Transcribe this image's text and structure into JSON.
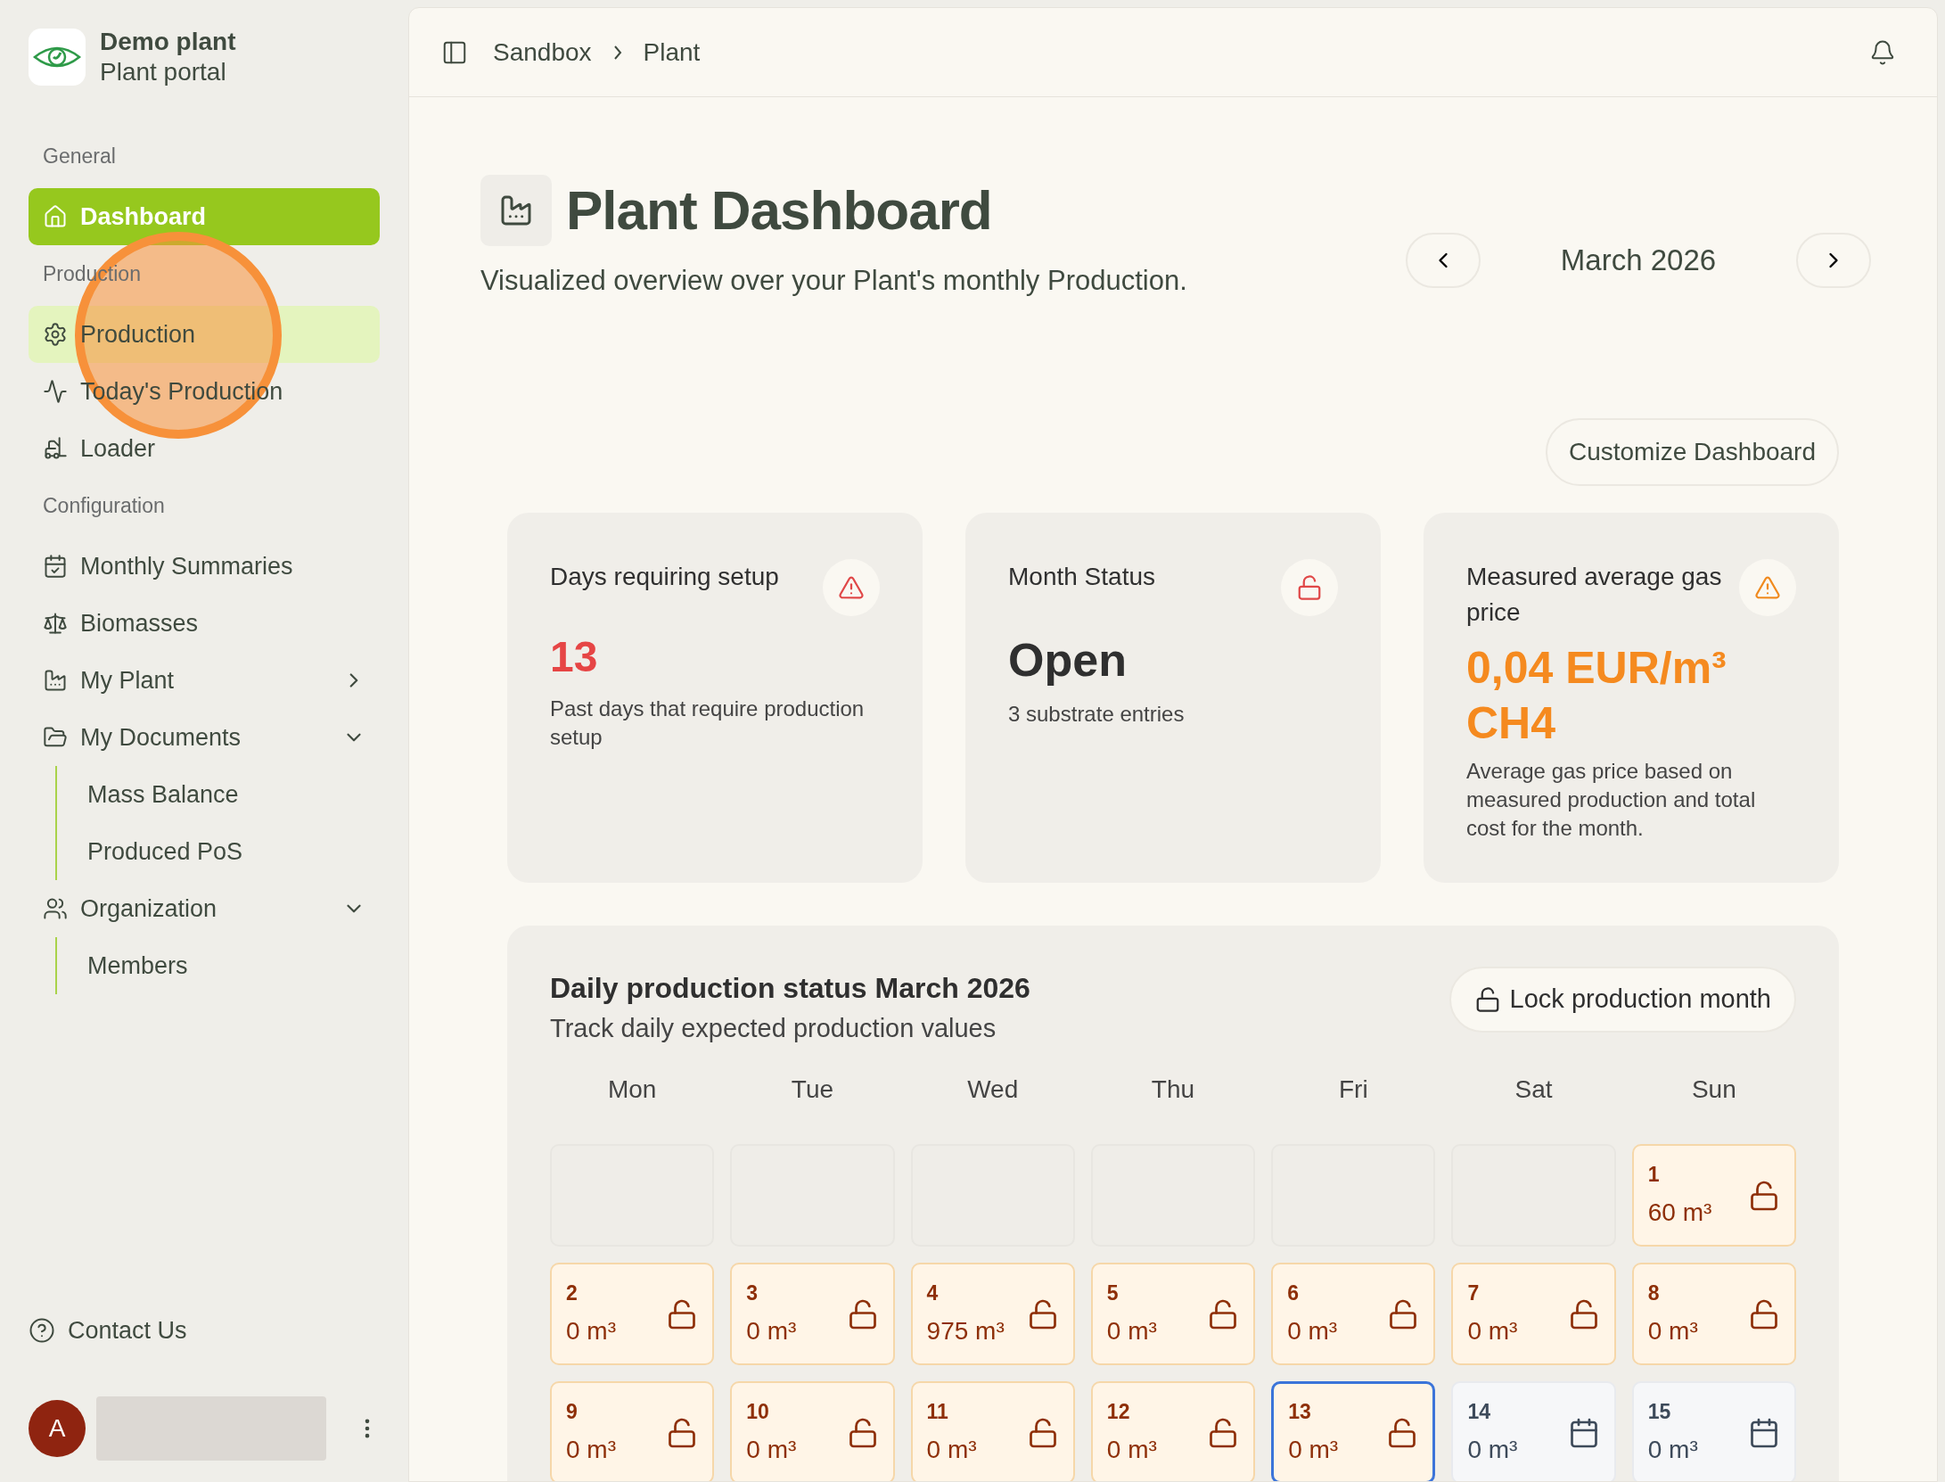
{
  "brand": {
    "name": "Demo plant",
    "subtitle": "Plant portal"
  },
  "sidebar": {
    "sections": [
      {
        "title": "General",
        "items": [
          {
            "label": "Dashboard",
            "selected": true,
            "hovered": false
          }
        ]
      },
      {
        "title": "Production",
        "items": [
          {
            "label": "Production",
            "selected": false,
            "hovered": true
          },
          {
            "label": "Today's Production",
            "selected": false,
            "hovered": false
          },
          {
            "label": "Loader",
            "selected": false,
            "hovered": false
          }
        ]
      },
      {
        "title": "Configuration",
        "items": [
          {
            "label": "Monthly Summaries",
            "selected": false,
            "hovered": false
          },
          {
            "label": "Biomasses",
            "selected": false,
            "hovered": false
          },
          {
            "label": "My Plant",
            "selected": false,
            "hovered": false,
            "expanded": false
          },
          {
            "label": "My Documents",
            "selected": false,
            "hovered": false,
            "expanded": true,
            "children": [
              {
                "label": "Mass Balance"
              },
              {
                "label": "Produced PoS"
              }
            ]
          },
          {
            "label": "Organization",
            "selected": false,
            "hovered": false,
            "expanded": true,
            "children": [
              {
                "label": "Members"
              }
            ]
          }
        ]
      }
    ],
    "contact": "Contact Us",
    "user": {
      "initial": "A"
    }
  },
  "cursor_highlight": {
    "on": true
  },
  "breadcrumb": [
    "Sandbox",
    "Plant"
  ],
  "page": {
    "title": "Plant Dashboard",
    "subtitle": "Visualized overview over your Plant's monthly Production.",
    "month": "March 2026",
    "customize": "Customize Dashboard"
  },
  "cards": [
    {
      "kind": "danger",
      "title": "Days requiring setup",
      "value": "13",
      "description": "Past days that require production setup"
    },
    {
      "kind": "status",
      "title": "Month Status",
      "value": "Open",
      "description": "3 substrate entries"
    },
    {
      "kind": "warning",
      "title": "Measured average gas price",
      "value": "0,04 EUR/m³ CH4",
      "description": "Average gas price based on measured production and total cost for the month."
    }
  ],
  "calendar": {
    "title": "Daily production status March 2026",
    "subtitle": "Track daily expected production values",
    "lock_button": "Lock production month",
    "weekdays": [
      "Mon",
      "Tue",
      "Wed",
      "Thu",
      "Fri",
      "Sat",
      "Sun"
    ],
    "weeks": [
      [
        {
          "kind": "empty"
        },
        {
          "kind": "empty"
        },
        {
          "kind": "empty"
        },
        {
          "kind": "empty"
        },
        {
          "kind": "empty"
        },
        {
          "kind": "empty"
        },
        {
          "kind": "open",
          "day": "1",
          "value": "60 m³",
          "selected": false
        }
      ],
      [
        {
          "kind": "open",
          "day": "2",
          "value": "0 m³",
          "selected": false
        },
        {
          "kind": "open",
          "day": "3",
          "value": "0 m³",
          "selected": false
        },
        {
          "kind": "open",
          "day": "4",
          "value": "975 m³",
          "selected": false
        },
        {
          "kind": "open",
          "day": "5",
          "value": "0 m³",
          "selected": false
        },
        {
          "kind": "open",
          "day": "6",
          "value": "0 m³",
          "selected": false
        },
        {
          "kind": "open",
          "day": "7",
          "value": "0 m³",
          "selected": false
        },
        {
          "kind": "open",
          "day": "8",
          "value": "0 m³",
          "selected": false
        }
      ],
      [
        {
          "kind": "open",
          "day": "9",
          "value": "0 m³",
          "selected": false
        },
        {
          "kind": "open",
          "day": "10",
          "value": "0 m³",
          "selected": false
        },
        {
          "kind": "open",
          "day": "11",
          "value": "0 m³",
          "selected": false
        },
        {
          "kind": "open",
          "day": "12",
          "value": "0 m³",
          "selected": false
        },
        {
          "kind": "open",
          "day": "13",
          "value": "0 m³",
          "selected": true
        },
        {
          "kind": "future",
          "day": "14",
          "value": "0 m³",
          "selected": false
        },
        {
          "kind": "future",
          "day": "15",
          "value": "0 m³",
          "selected": false
        }
      ]
    ]
  }
}
